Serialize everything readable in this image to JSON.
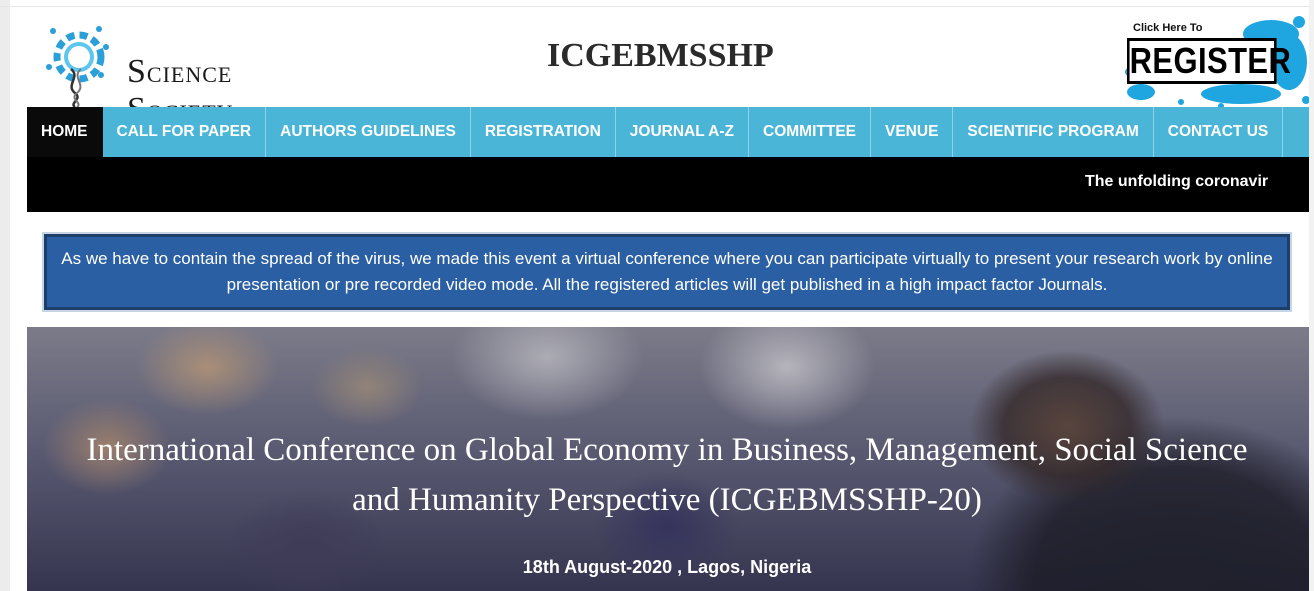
{
  "header": {
    "logo_text": "Science Society",
    "logo_big_s1": "S",
    "logo_small_1": "CIENCE",
    "logo_big_s2": "S",
    "logo_small_2": "OCIETY",
    "site_title": "ICGEBMSSHP",
    "register_prompt": "Click Here To",
    "register_label": "REGISTER"
  },
  "nav": {
    "items": [
      {
        "label": "HOME"
      },
      {
        "label": "CALL FOR PAPER"
      },
      {
        "label": "AUTHORS GUIDELINES"
      },
      {
        "label": "REGISTRATION"
      },
      {
        "label": "JOURNAL A-Z"
      },
      {
        "label": "COMMITTEE"
      },
      {
        "label": "VENUE"
      },
      {
        "label": "SCIENTIFIC PROGRAM"
      },
      {
        "label": "CONTACT US"
      }
    ]
  },
  "ticker": {
    "text": "The unfolding coronavir"
  },
  "notice": {
    "text": "As we have to contain the spread of the virus, we made this event a virtual conference where you can participate virtually to present your research work by online presentation or pre recorded video mode. All the registered articles will get published in a high impact factor Journals."
  },
  "hero": {
    "title": "International Conference on Global Economy in Business, Management, Social Science and Humanity Perspective (ICGEBMSSHP-20)",
    "date_location": "18th August-2020 , Lagos, Nigeria"
  },
  "colors": {
    "nav_bg": "#4bb5d8",
    "nav_active": "#0a0a0a",
    "notice_bg": "#2b5fa3"
  }
}
